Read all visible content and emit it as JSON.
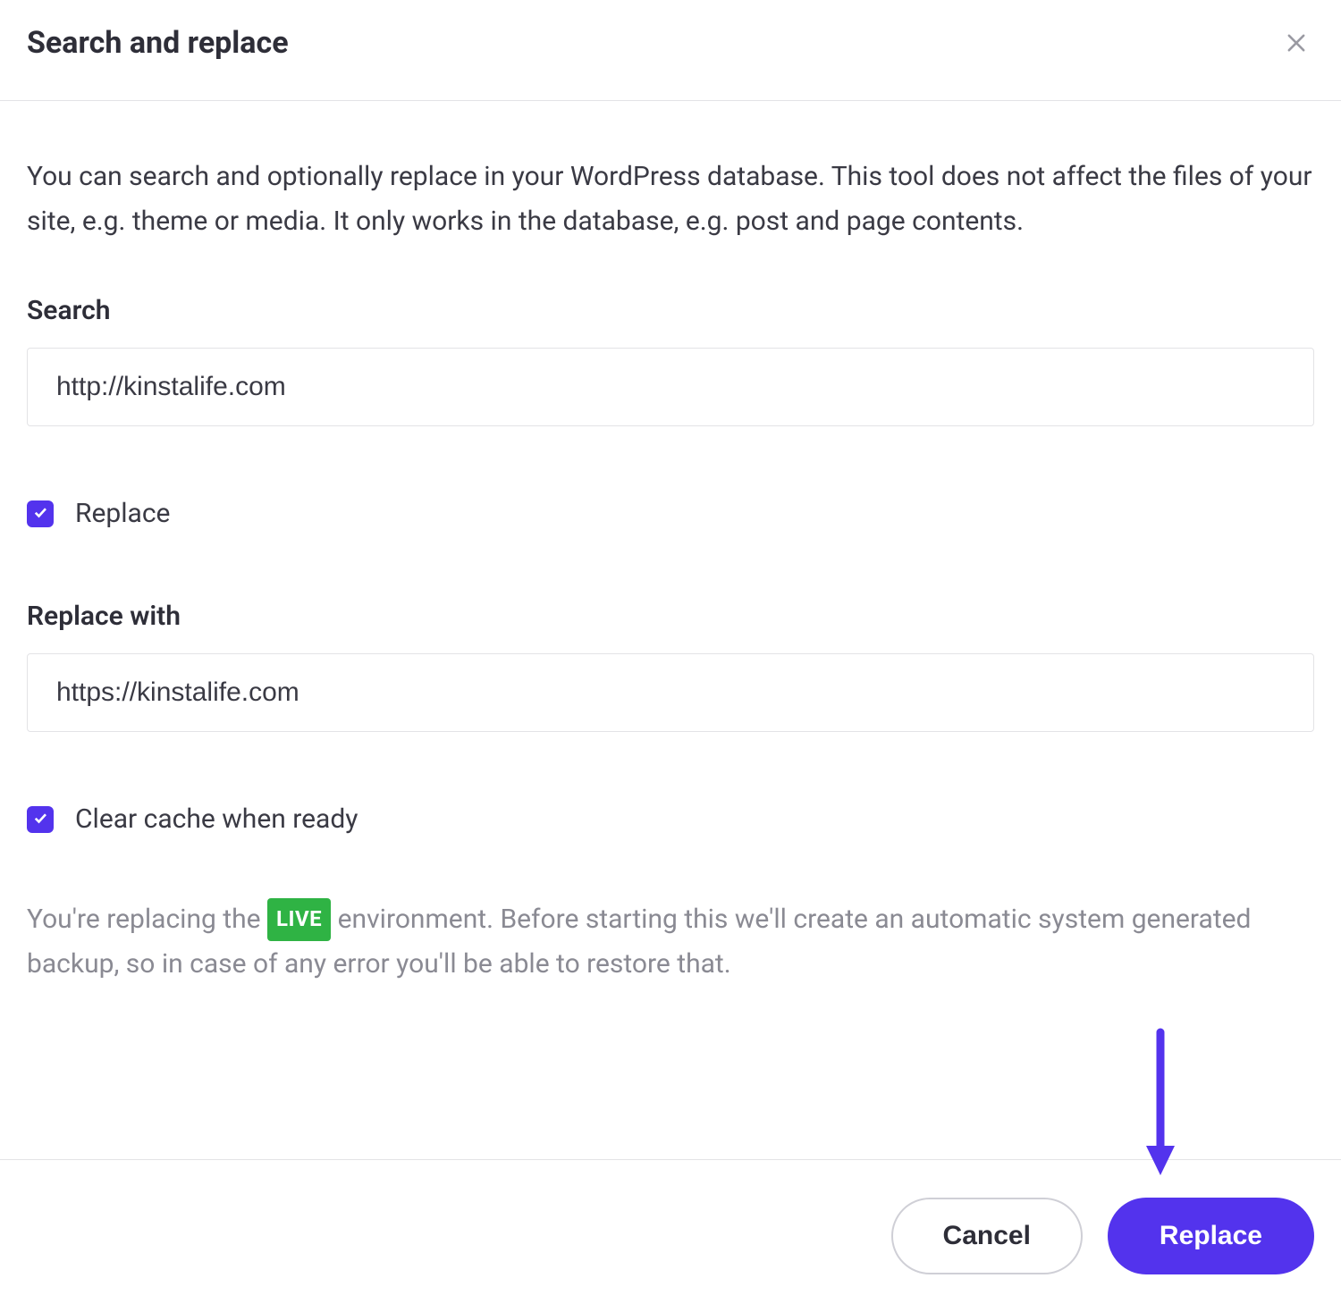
{
  "header": {
    "title": "Search and replace"
  },
  "description": "You can search and optionally replace in your WordPress database. This tool does not affect the files of your site, e.g. theme or media. It only works in the database, e.g. post and page contents.",
  "search": {
    "label": "Search",
    "value": "http://kinstalife.com"
  },
  "replace_toggle": {
    "label": "Replace",
    "checked": true
  },
  "replace_with": {
    "label": "Replace with",
    "value": "https://kinstalife.com"
  },
  "clear_cache": {
    "label": "Clear cache when ready",
    "checked": true
  },
  "warning": {
    "prefix": "You're replacing the ",
    "env_badge": "LIVE",
    "suffix": " environment. Before starting this we'll create an automatic system generated backup, so in case of any error you'll be able to restore that."
  },
  "footer": {
    "cancel_label": "Cancel",
    "submit_label": "Replace"
  },
  "colors": {
    "accent": "#5333ed",
    "env_badge": "#2fb344"
  }
}
